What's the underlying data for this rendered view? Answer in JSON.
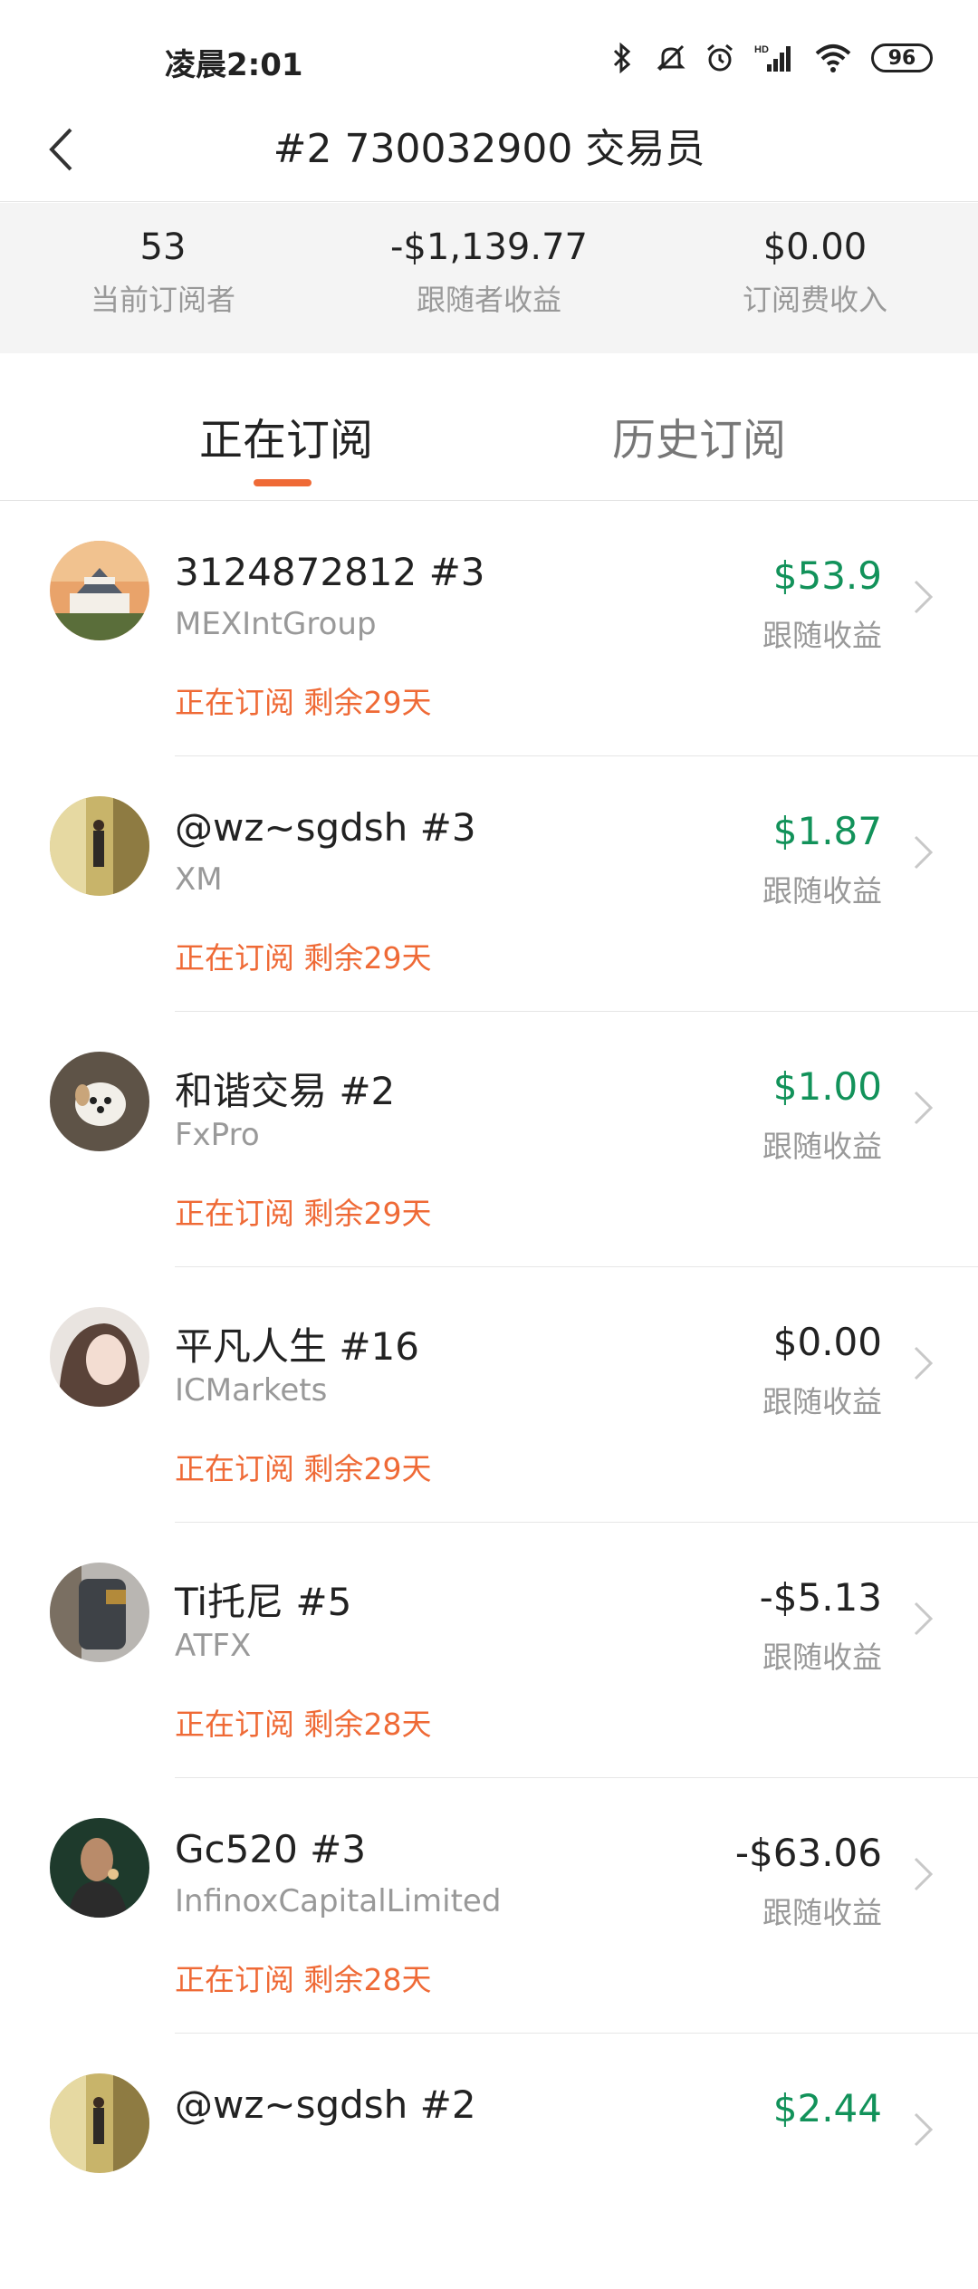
{
  "status_bar": {
    "time": "凌晨2:01",
    "icons": [
      "bluetooth-icon",
      "mute-bell-icon",
      "alarm-icon",
      "hd-signal-icon",
      "wifi-icon"
    ],
    "hd_label": "HD",
    "battery": "96"
  },
  "header": {
    "title": "#2 730032900 交易员"
  },
  "stats": [
    {
      "value": "53",
      "label": "当前订阅者"
    },
    {
      "value": "-$1,139.77",
      "label": "跟随者收益"
    },
    {
      "value": "$0.00",
      "label": "订阅费收入"
    }
  ],
  "tabs": [
    {
      "label": "正在订阅",
      "active": true
    },
    {
      "label": "历史订阅",
      "active": false
    }
  ],
  "colors": {
    "accent": "#ef6a36",
    "positive": "#12925a"
  },
  "subscriptions": [
    {
      "name": "3124872812 #3",
      "broker": "MEXIntGroup",
      "status": "正在订阅 剩余29天",
      "amount": "$53.9",
      "amount_label": "跟随收益",
      "sign": "pos"
    },
    {
      "name": "@wz~sgdsh #3",
      "broker": "XM",
      "status": "正在订阅 剩余29天",
      "amount": "$1.87",
      "amount_label": "跟随收益",
      "sign": "pos"
    },
    {
      "name": "和谐交易 #2",
      "broker": "FxPro",
      "status": "正在订阅 剩余29天",
      "amount": "$1.00",
      "amount_label": "跟随收益",
      "sign": "pos"
    },
    {
      "name": "平凡人生 #16",
      "broker": "ICMarkets",
      "status": "正在订阅 剩余29天",
      "amount": "$0.00",
      "amount_label": "跟随收益",
      "sign": "zero"
    },
    {
      "name": "Ti托尼 #5",
      "broker": "ATFX",
      "status": "正在订阅 剩余28天",
      "amount": "-$5.13",
      "amount_label": "跟随收益",
      "sign": "neg"
    },
    {
      "name": "Gc520 #3",
      "broker": "InfinoxCapitalLimited",
      "status": "正在订阅 剩余28天",
      "amount": "-$63.06",
      "amount_label": "跟随收益",
      "sign": "neg"
    },
    {
      "name": "@wz~sgdsh #2",
      "broker": "",
      "status": "",
      "amount": "$2.44",
      "amount_label": "",
      "sign": "pos"
    }
  ]
}
